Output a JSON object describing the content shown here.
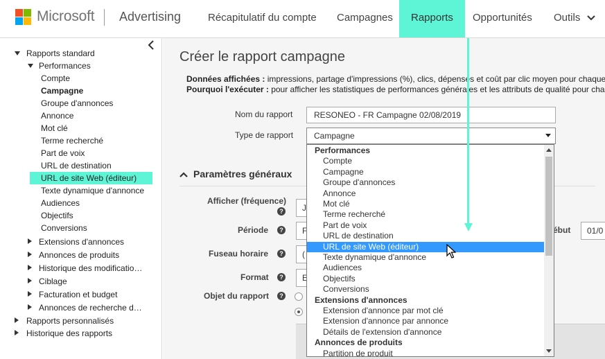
{
  "colors": {
    "accent": "#5ef5d6",
    "selection": "#3399ff",
    "ms_red": "#f25022",
    "ms_green": "#7fba00",
    "ms_blue": "#00a4ef",
    "ms_yellow": "#ffb900"
  },
  "header": {
    "brand": "Microsoft",
    "product": "Advertising",
    "nav": [
      "Récapitulatif du compte",
      "Campagnes",
      "Rapports",
      "Opportunités",
      "Outils"
    ],
    "active_nav": "Rapports"
  },
  "sidebar": {
    "root1": "Rapports standard",
    "perf": "Performances",
    "perf_items": [
      "Compte",
      "Campagne",
      "Groupe d'annonces",
      "Annonce",
      "Mot clé",
      "Terme recherché",
      "Part de voix",
      "URL de destination",
      "URL de site Web (éditeur)",
      "Texte dynamique d'annonce",
      "Audiences",
      "Objectifs",
      "Conversions"
    ],
    "groups": [
      "Extensions d'annonces",
      "Annonces de produits",
      "Historique des modificatio…",
      "Ciblage",
      "Facturation et budget",
      "Annonces de recherche d…"
    ],
    "root2": "Rapports personnalisés",
    "root3": "Historique des rapports"
  },
  "main": {
    "title": "Créer le rapport campagne",
    "data_label": "Données affichées :",
    "data_text": " impressions, partage d'impressions (%), clics, dépenses et coût par clic moyen pour chaque",
    "why_label": "Pourquoi l'exécuter :",
    "why_text": " pour afficher les statistiques de performances générales et les attributs de qualité pour chac",
    "name_label": "Nom du rapport",
    "name_value": "RESONEO - FR Campagne 02/08/2019",
    "type_label": "Type de rapport",
    "type_value": "Campagne",
    "section": "Paramètres généraux",
    "freq_label": "Afficher (fréquence)",
    "freq_value": "J",
    "period_label": "Période",
    "period_value": "F",
    "debut_label": "ébut",
    "debut_value": "01/0",
    "tz_label": "Fuseau horaire",
    "tz_value": "(",
    "format_label": "Format",
    "format_value": "E",
    "objet_label": "Objet du rapport",
    "help": "?"
  },
  "dropdown": {
    "rows": [
      {
        "t": "Performances",
        "g": true
      },
      {
        "t": "Compte"
      },
      {
        "t": "Campagne"
      },
      {
        "t": "Groupe d'annonces"
      },
      {
        "t": "Annonce"
      },
      {
        "t": "Mot clé"
      },
      {
        "t": "Terme recherché"
      },
      {
        "t": "Part de voix"
      },
      {
        "t": "URL de destination"
      },
      {
        "t": "URL de site Web (éditeur)",
        "s": true
      },
      {
        "t": "Texte dynamique d'annonce"
      },
      {
        "t": "Audiences"
      },
      {
        "t": "Objectifs"
      },
      {
        "t": "Conversions"
      },
      {
        "t": "Extensions d'annonces",
        "g": true
      },
      {
        "t": "Extension d'annonce par mot clé"
      },
      {
        "t": "Extension d'annonce par annonce"
      },
      {
        "t": "Détails de l'extension d'annonce"
      },
      {
        "t": "Annonces de produits",
        "g": true
      },
      {
        "t": "Partition de produit"
      }
    ]
  }
}
